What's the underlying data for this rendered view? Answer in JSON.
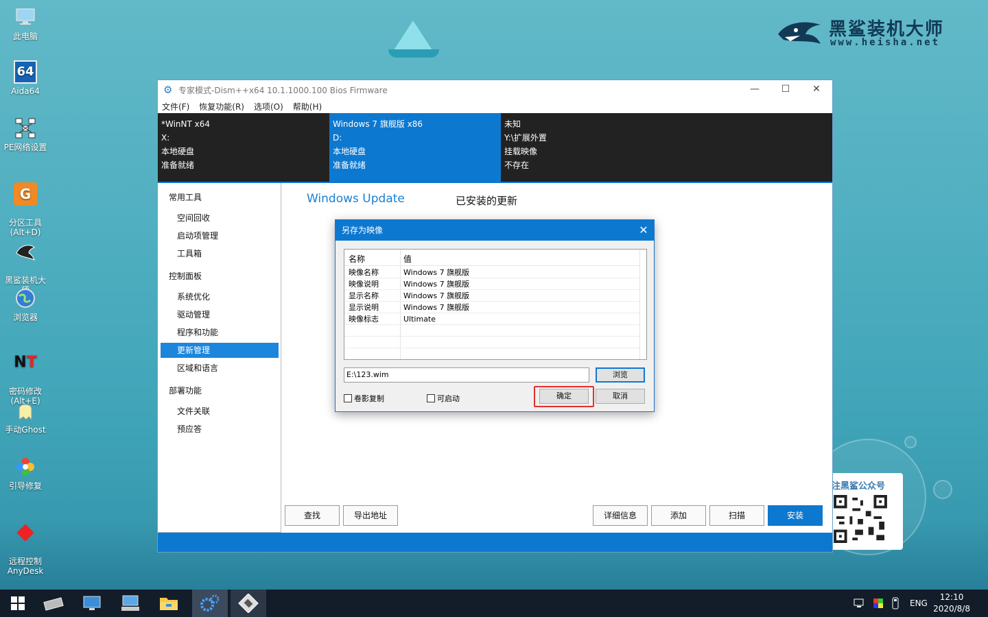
{
  "desktop": {
    "icons": [
      {
        "label": "此电脑",
        "icon": "computer-icon"
      },
      {
        "label": "Aida64",
        "icon": "aida64-icon",
        "glyph": "64"
      },
      {
        "label": "PE网络设置",
        "icon": "network-icon"
      },
      {
        "label": "分区工具\n(Alt+D)",
        "icon": "partition-tool-icon"
      },
      {
        "label": "黑鲨装机大\n师",
        "icon": "heisha-icon"
      },
      {
        "label": "浏览器",
        "icon": "browser-icon"
      },
      {
        "label": "密码修改\n(Alt+E)",
        "icon": "password-icon"
      },
      {
        "label": "手动Ghost",
        "icon": "ghost-icon"
      },
      {
        "label": "引导修复",
        "icon": "boot-repair-icon"
      },
      {
        "label": "远程控制\nAnyDesk",
        "icon": "anydesk-icon"
      }
    ],
    "logo": {
      "title": "黑鲨装机大师",
      "url": "www.heisha.net"
    },
    "qr_card": {
      "title": "注黑鲨公众号"
    }
  },
  "window": {
    "title": "专家模式-Dism++x64 10.1.1000.100 Bios Firmware",
    "controls": {
      "minimize": "—",
      "maximize": "☐",
      "close": "✕"
    },
    "menu": [
      "文件(F)",
      "恢复功能(R)",
      "选项(O)",
      "帮助(H)"
    ],
    "drives": [
      {
        "line1": "*WinNT x64",
        "line2": "X:",
        "line3": "本地硬盘",
        "line4": "准备就绪",
        "selected": false
      },
      {
        "line1": "Windows 7 旗舰版 x86",
        "line2": "D:",
        "line3": "本地硬盘",
        "line4": "准备就绪",
        "selected": true
      },
      {
        "line1": "未知",
        "line2": "Y:\\扩展外置",
        "line3": "挂载映像",
        "line4": "不存在",
        "selected": false
      }
    ],
    "sidebar": {
      "group1": "常用工具",
      "g1_items": [
        "空间回收",
        "启动项管理",
        "工具箱"
      ],
      "group2": "控制面板",
      "g2_items": [
        "系统优化",
        "驱动管理",
        "程序和功能",
        "更新管理",
        "区域和语言"
      ],
      "group3": "部署功能",
      "g3_items": [
        "文件关联",
        "预应答"
      ],
      "active": "更新管理"
    },
    "content": {
      "tab_active": "Windows Update",
      "tab_other": "已安装的更新"
    },
    "buttons": {
      "find": "查找",
      "export": "导出地址",
      "details": "详细信息",
      "add": "添加",
      "scan": "扫描",
      "install": "安装"
    }
  },
  "dialog": {
    "title": "另存为映像",
    "close": "✕",
    "columns": {
      "name": "名称",
      "value": "值"
    },
    "rows": [
      {
        "name": "映像名称",
        "value": "Windows 7 旗舰版"
      },
      {
        "name": "映像说明",
        "value": "Windows 7 旗舰版"
      },
      {
        "name": "显示名称",
        "value": "Windows 7 旗舰版"
      },
      {
        "name": "显示说明",
        "value": "Windows 7 旗舰版"
      },
      {
        "name": "映像标志",
        "value": "Ultimate"
      }
    ],
    "path_value": "E:\\123.wim",
    "browse": "浏览",
    "shadow_copy": "卷影复制",
    "bootable": "可启动",
    "ok": "确定",
    "cancel": "取消"
  },
  "taskbar": {
    "lang": "ENG",
    "time": "12:10",
    "date": "2020/8/8"
  },
  "colors": {
    "accent": "#0d78d0",
    "highlight": "#e42e2e",
    "taskbar": "#131c29"
  }
}
